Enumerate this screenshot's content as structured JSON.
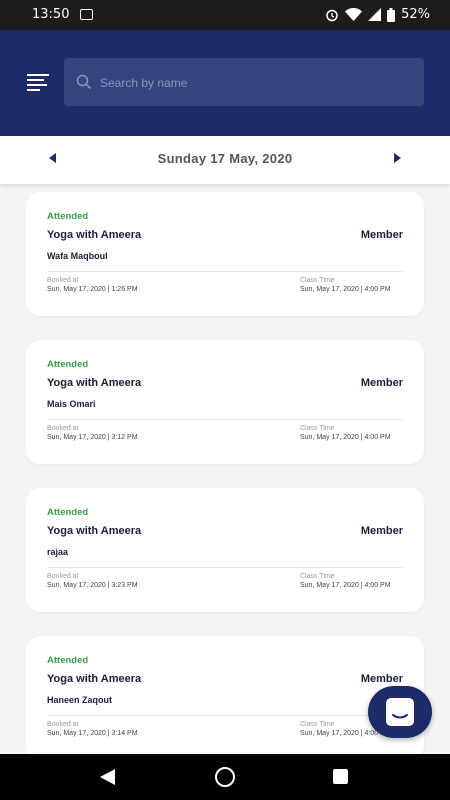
{
  "status_bar": {
    "time": "13:50",
    "battery": "52%"
  },
  "header": {
    "search_placeholder": "Search by name"
  },
  "date_bar": {
    "date": "Sunday 17 May, 2020"
  },
  "labels": {
    "booked_at": "Booked at",
    "class_time": "Class Time"
  },
  "bookings": [
    {
      "status": "Attended",
      "class_name": "Yoga with Ameera",
      "role": "Member",
      "name": "Wafa Maqboul",
      "booked_at": "Sun, May 17, 2020 | 1:26 PM",
      "class_time": "Sun, May 17, 2020 | 4:00 PM"
    },
    {
      "status": "Attended",
      "class_name": "Yoga with Ameera",
      "role": "Member",
      "name": "Mais Omari",
      "booked_at": "Sun, May 17, 2020 | 3:12 PM",
      "class_time": "Sun, May 17, 2020 | 4:00 PM"
    },
    {
      "status": "Attended",
      "class_name": "Yoga with Ameera",
      "role": "Member",
      "name": "rajaa",
      "booked_at": "Sun, May 17, 2020 | 3:23 PM",
      "class_time": "Sun, May 17, 2020 | 4:00 PM"
    },
    {
      "status": "Attended",
      "class_name": "Yoga with Ameera",
      "role": "Member",
      "name": "Haneen Zaqout",
      "booked_at": "Sun, May 17, 2020 | 3:14 PM",
      "class_time": "Sun, May 17, 2020 | 4:00 PM"
    }
  ],
  "colors": {
    "primary": "#1d2b66",
    "attended": "#39a04a",
    "background": "#f4f4f6"
  },
  "icons": {
    "menu": "menu-icon",
    "search": "search-icon",
    "prev": "chevron-left-icon",
    "next": "chevron-right-icon",
    "chat": "chat-icon"
  }
}
